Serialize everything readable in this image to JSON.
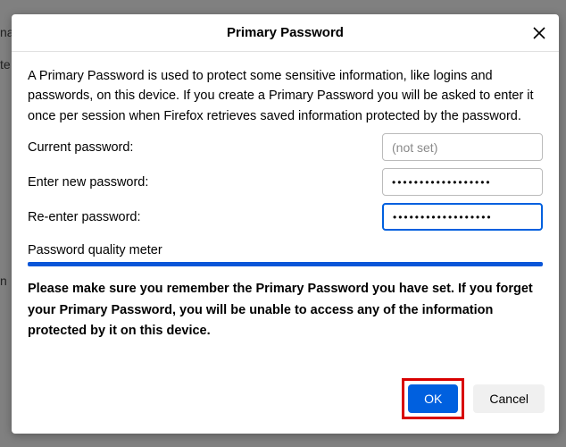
{
  "dialog": {
    "title": "Primary Password",
    "intro": "A Primary Password is used to protect some sensitive information, like logins and passwords, on this device. If you create a Primary Password you will be asked to enter it once per session when Firefox retrieves saved information protected by the password.",
    "current_label": "Current password:",
    "current_placeholder": "(not set)",
    "current_value": "",
    "new_label": "Enter new password:",
    "new_value": "••••••••••••••••••",
    "reenter_label": "Re-enter password:",
    "reenter_value": "••••••••••••••••••",
    "meter_label": "Password quality meter",
    "warning": "Please make sure you remember the Primary Password you have set. If you forget your Primary Password, you will be unable to access any of the information protected by it on this device.",
    "ok": "OK",
    "cancel": "Cancel"
  }
}
